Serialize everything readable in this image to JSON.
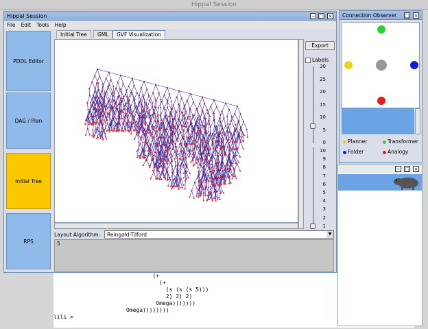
{
  "outer_title": "Hippal Session",
  "session": {
    "title": "Hippal Session",
    "menu": [
      "File",
      "Edit",
      "Tools",
      "Help"
    ]
  },
  "nav": {
    "items": [
      {
        "label": "PDDL Editor"
      },
      {
        "label": "DAG / Plan"
      },
      {
        "label": "Initial Tree"
      },
      {
        "label": "RPS"
      }
    ],
    "active": "Initial Tree",
    "accent": "#8fbaea",
    "active_color": "#fbc800"
  },
  "tabs": {
    "items": [
      "Initial Tree",
      "GML",
      "GVF Visualization"
    ],
    "active": "GVF Visualization"
  },
  "controls": {
    "export": "Export",
    "labels": "Labels",
    "labels_checked": false,
    "upper_ticks": [
      "30",
      "25",
      "20",
      "15",
      "10",
      "5",
      "0"
    ],
    "lower_ticks": [
      "10",
      "9",
      "8",
      "7",
      "6",
      "5",
      "4",
      "3",
      "2",
      "1"
    ]
  },
  "layout": {
    "label": "Layout Algorithm:",
    "value": "Reingold-Tilford"
  },
  "status_value": "5",
  "console": {
    "lines": [
      "                              (+",
      "                                (+",
      "                                  (s (s (s 5)))",
      "                                  2) 2) 2)",
      "                               Omega)))))))",
      "                      Omega))))))))",
      "lili > "
    ]
  },
  "observer": {
    "title": "Connection Observer",
    "legend": [
      {
        "label": "Planner",
        "color": "#f0d020"
      },
      {
        "label": "Transformer",
        "color": "#30d030"
      },
      {
        "label": "Folder",
        "color": "#1020d0"
      },
      {
        "label": "Analogy",
        "color": "#e02020"
      }
    ]
  },
  "colors": {
    "tree_edge": "#2a2aa8",
    "tree_node": "#e03040"
  }
}
